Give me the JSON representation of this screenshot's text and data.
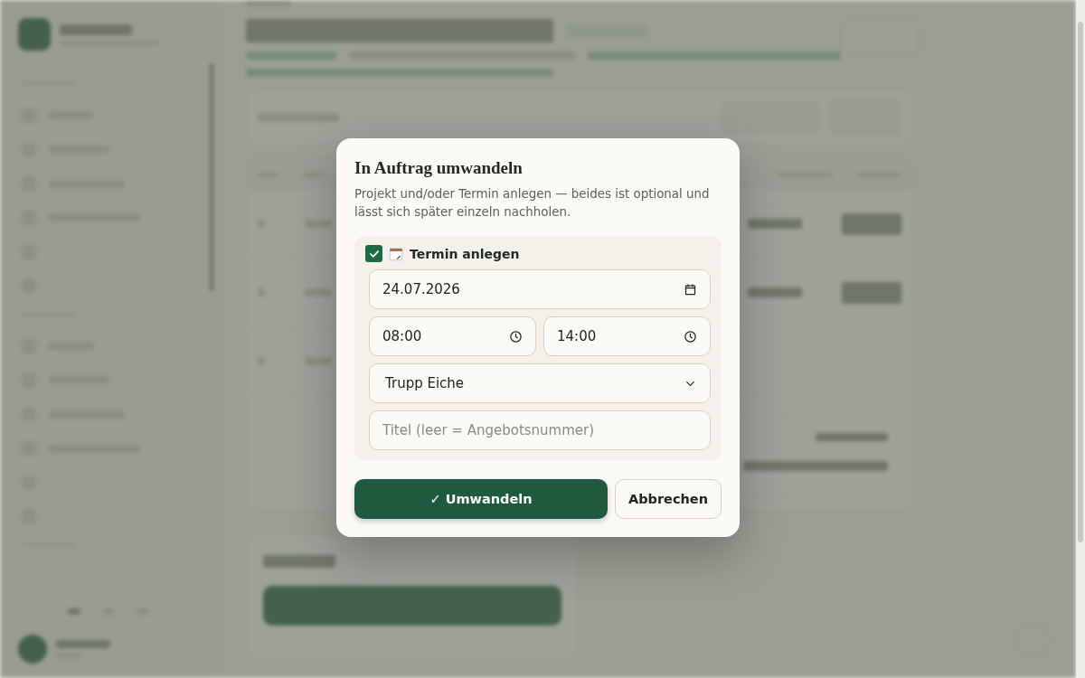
{
  "dialog": {
    "title": "In Auftrag umwandeln",
    "description": "Projekt und/oder Termin anlegen — beides ist optional und lässt sich später einzeln nachholen.",
    "appointment": {
      "label": "Termin anlegen",
      "checked": true,
      "date": "24.07.2026",
      "start": "08:00",
      "end": "14:00",
      "team": "Trupp Eiche",
      "title_placeholder": "Titel (leer = Angebotsnummer)"
    },
    "confirm_button": "✓ Umwandeln",
    "cancel_button": "Abbrechen"
  }
}
